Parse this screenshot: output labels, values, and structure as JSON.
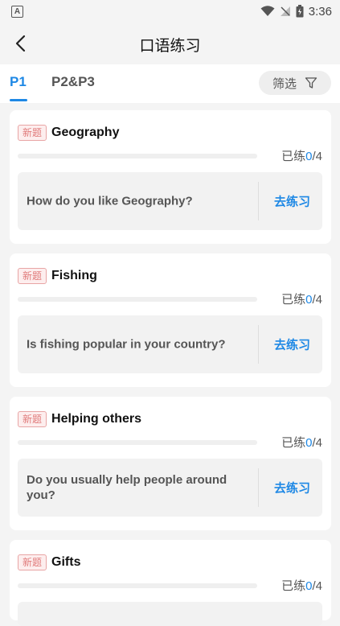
{
  "status": {
    "time": "3:36"
  },
  "header": {
    "title": "口语练习"
  },
  "tabs": [
    {
      "label": "P1"
    },
    {
      "label": "P2&P3"
    }
  ],
  "filter": {
    "label": "筛选"
  },
  "colors": {
    "accent": "#1e88e5",
    "badge": "#e07a7a",
    "background": "#f4f4f4"
  },
  "cards": [
    {
      "badge": "新题",
      "title": "Geography",
      "progress_prefix": "已练",
      "done": "0",
      "total": "/4",
      "progress": 0,
      "question": "How do you like Geography?",
      "action": "去练习"
    },
    {
      "badge": "新题",
      "title": "Fishing",
      "progress_prefix": "已练",
      "done": "0",
      "total": "/4",
      "progress": 0,
      "question": "Is fishing popular in your country?",
      "action": "去练习"
    },
    {
      "badge": "新题",
      "title": "Helping others",
      "progress_prefix": "已练",
      "done": "0",
      "total": "/4",
      "progress": 0,
      "question": "Do you usually help people around you?",
      "action": "去练习"
    },
    {
      "badge": "新题",
      "title": "Gifts",
      "progress_prefix": "已练",
      "done": "0",
      "total": "/4",
      "progress": 0,
      "question": "",
      "action": ""
    }
  ]
}
